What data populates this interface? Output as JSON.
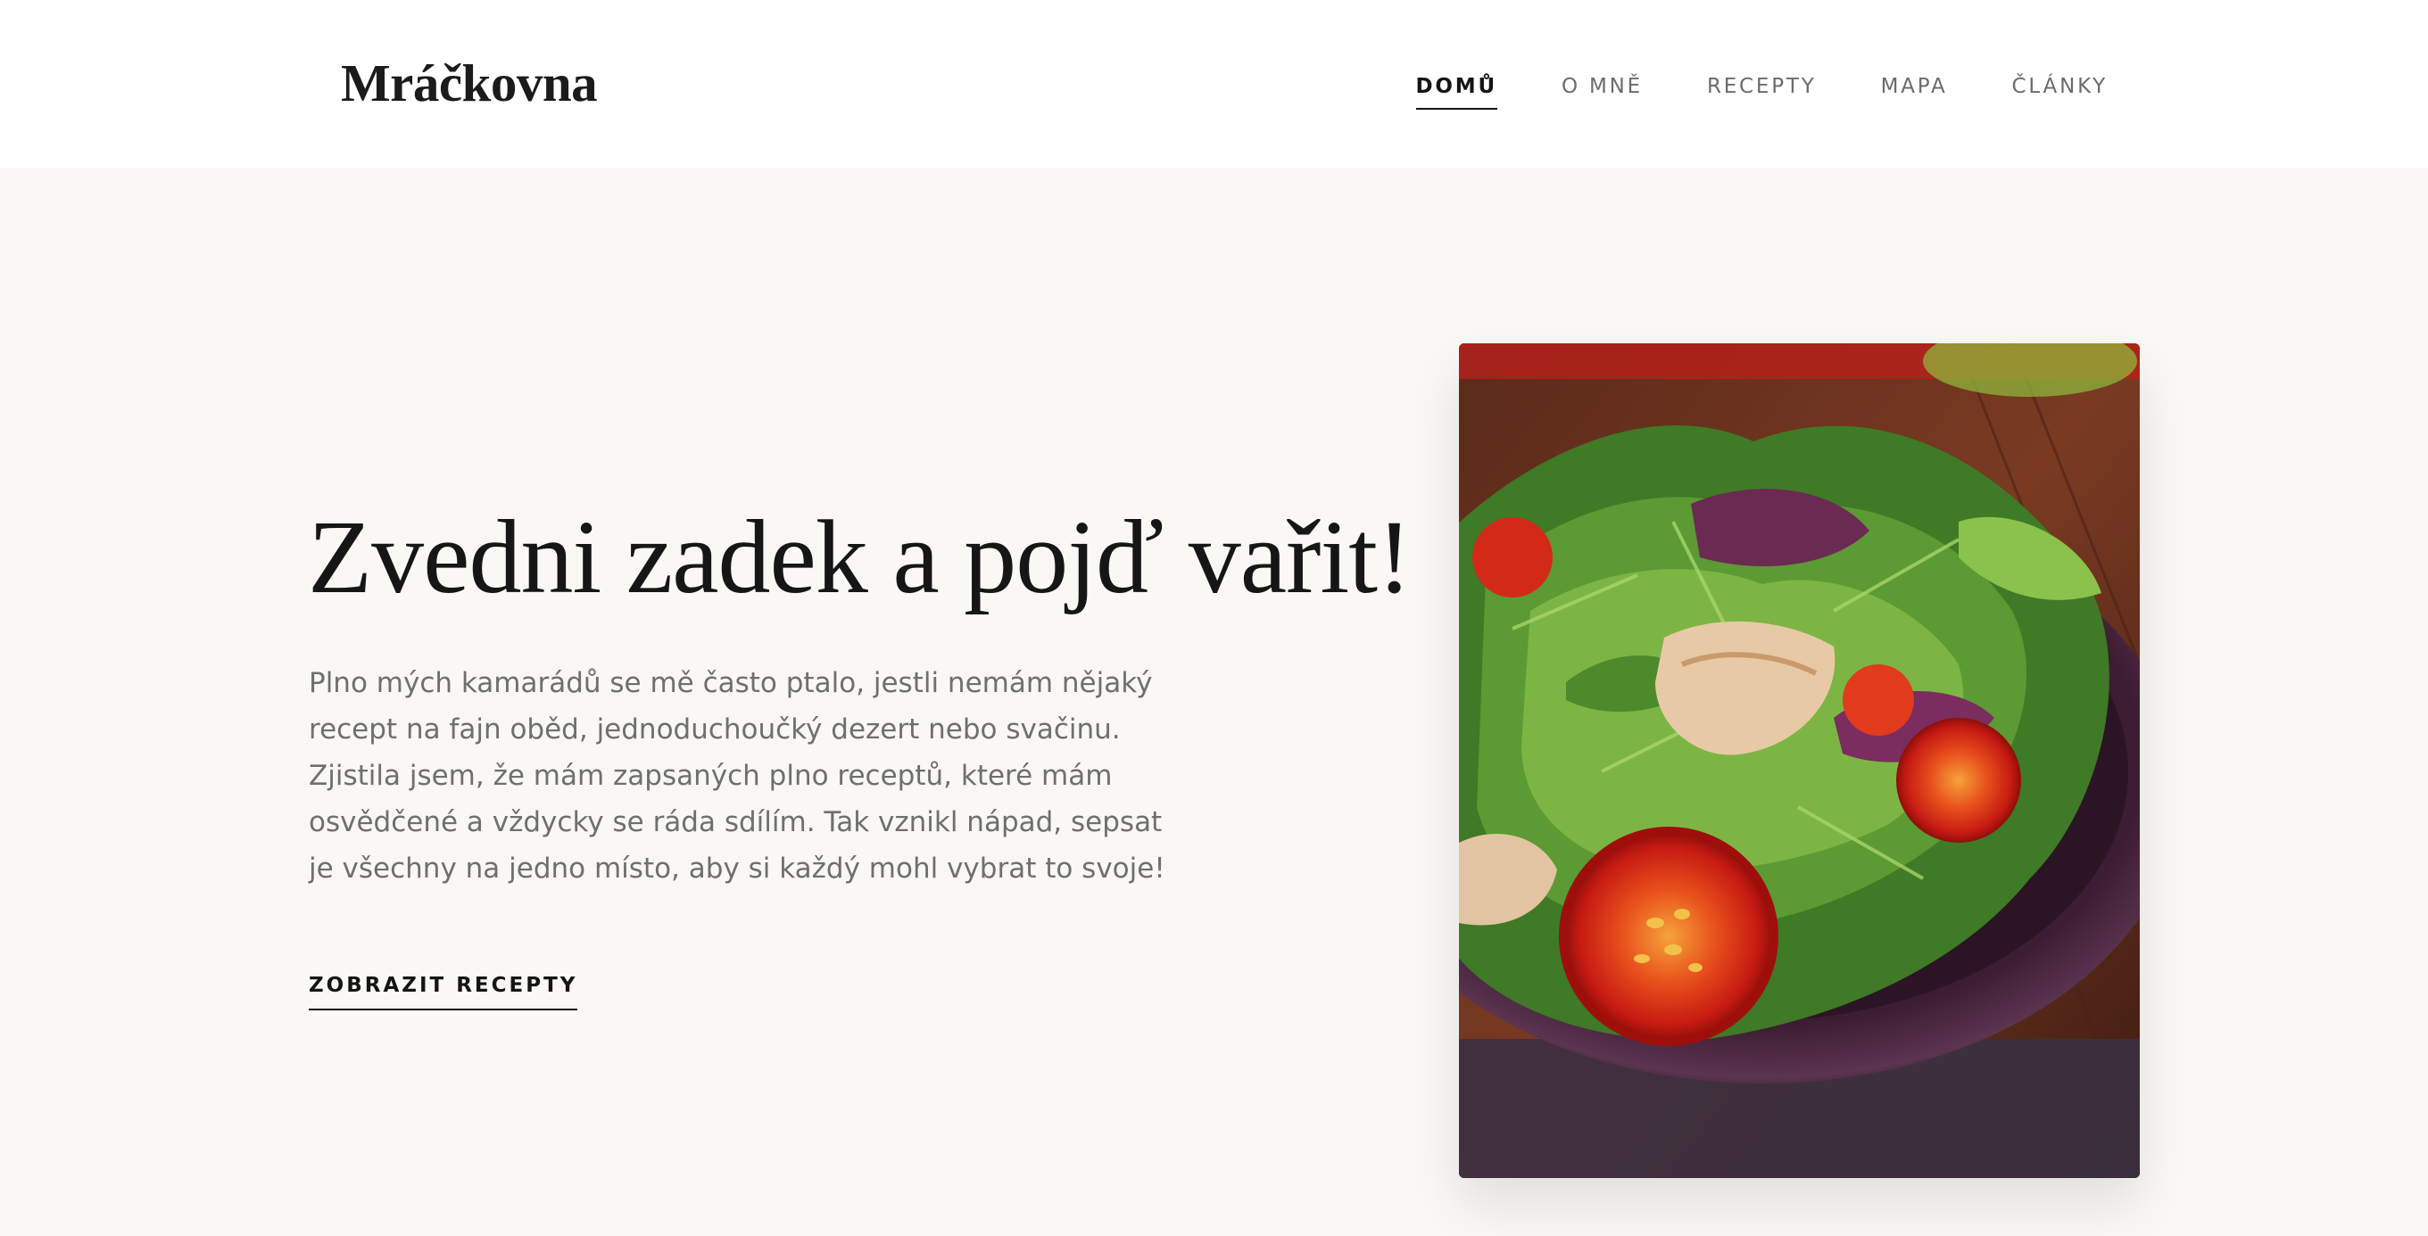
{
  "header": {
    "logo": "Mráčkovna",
    "nav": [
      "DOMŮ",
      "O MNĚ",
      "RECEPTY",
      "MAPA",
      "ČLÁNKY"
    ],
    "active_nav": "DOMŮ"
  },
  "hero": {
    "title": "Zvedni zadek a pojď vařit!",
    "text": "Plno mých kamarádů se mě často ptalo, jestli nemám nějaký recept na fajn oběd, jednoduchoučký dezert nebo svačinu. Zjistila jsem, že mám zapsaných plno receptů, které mám osvědčené a vždycky se ráda sdílím. Tak vznikl nápad, sepsat je všechny na jedno místo, aby si každý mohl vybrat to svoje!",
    "cta_label": "ZOBRAZIT RECEPTY",
    "image_icon": "salad-photo"
  },
  "colors": {
    "background": "#faf8f5",
    "header_bg": "#ffffff",
    "text_dark": "#161616",
    "text_muted": "#6f6f6f",
    "nav_muted": "#6b6b6b"
  }
}
